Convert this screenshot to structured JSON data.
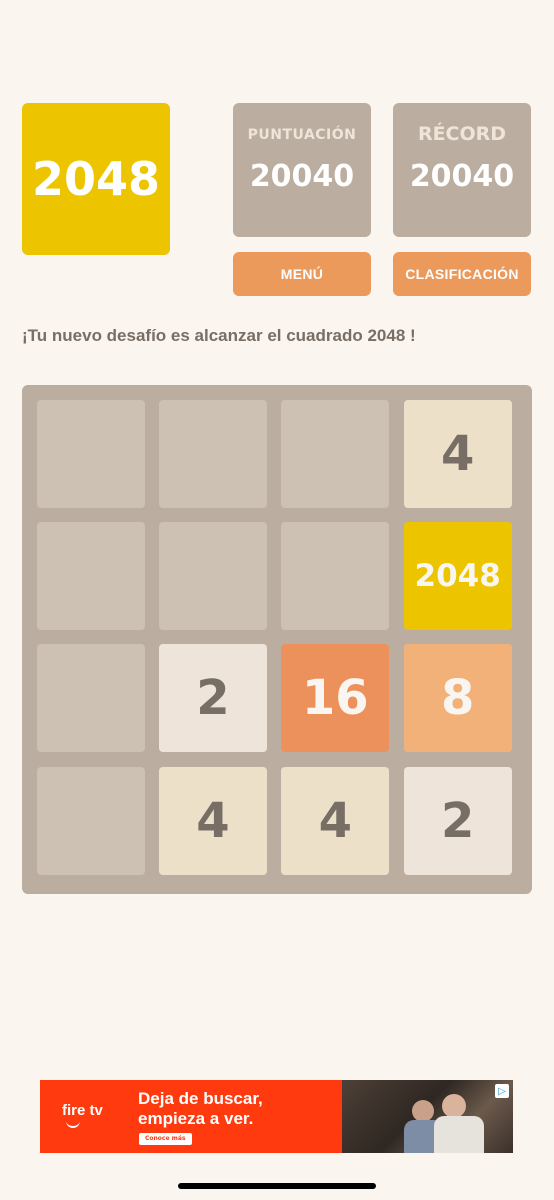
{
  "logo": {
    "label": "2048",
    "color": "#ecc400"
  },
  "scores": {
    "score_label": "PUNTUACIÓN",
    "score_value": "20040",
    "best_label": "RÉCORD",
    "best_value": "20040"
  },
  "buttons": {
    "menu_label": "MENÚ",
    "ranking_label": "CLASIFICACIÓN"
  },
  "tagline": "¡Tu nuevo desafío es alcanzar el cuadrado 2048 !",
  "board": {
    "size": 4,
    "tiles": [
      {
        "row": 0,
        "col": 3,
        "value": "4"
      },
      {
        "row": 1,
        "col": 3,
        "value": "2048"
      },
      {
        "row": 2,
        "col": 1,
        "value": "2"
      },
      {
        "row": 2,
        "col": 2,
        "value": "16"
      },
      {
        "row": 2,
        "col": 3,
        "value": "8"
      },
      {
        "row": 3,
        "col": 1,
        "value": "4"
      },
      {
        "row": 3,
        "col": 2,
        "value": "4"
      },
      {
        "row": 3,
        "col": 3,
        "value": "2"
      }
    ]
  },
  "ad": {
    "brand": "fire tv",
    "headline_line1": "Deja de buscar,",
    "headline_line2": "empieza a ver.",
    "cta": "Conoce más",
    "background_color": "#ff3a0f"
  },
  "colors": {
    "background": "#faf6ef",
    "board": "#bbada0",
    "empty_cell": "#cdc1b4",
    "button": "#ec9a5c",
    "text_dark": "#776e65"
  }
}
